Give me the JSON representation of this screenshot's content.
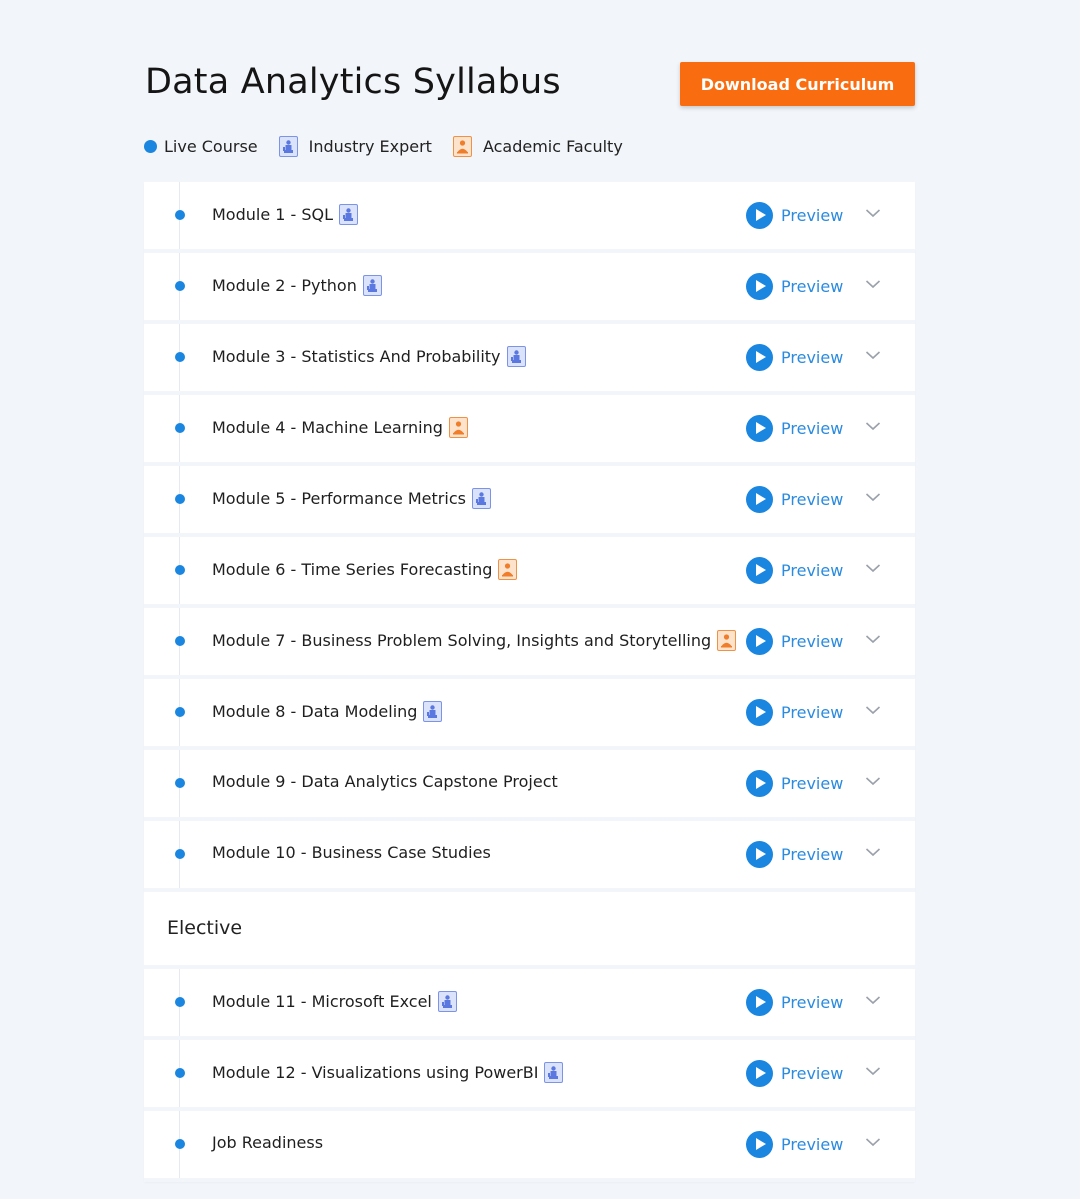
{
  "header": {
    "title": "Data Analytics Syllabus",
    "download_label": "Download Curriculum"
  },
  "legend": {
    "live": "Live Course",
    "expert": "Industry Expert",
    "faculty": "Academic Faculty"
  },
  "colors": {
    "accent_blue": "#1a86e0",
    "download_orange": "#f96d10",
    "background": "#f2f5f9"
  },
  "icons": {
    "expert": "industry-expert-icon",
    "faculty": "academic-faculty-icon",
    "preview": "play-icon",
    "expand": "chevron-down-icon"
  },
  "modules": [
    {
      "title": "Module 1 - SQL",
      "badge": "expert",
      "preview": "Preview"
    },
    {
      "title": "Module 2 - Python",
      "badge": "expert",
      "preview": "Preview"
    },
    {
      "title": "Module 3 - Statistics And Probability",
      "badge": "expert",
      "preview": "Preview"
    },
    {
      "title": "Module 4 - Machine Learning",
      "badge": "faculty",
      "preview": "Preview"
    },
    {
      "title": "Module 5 - Performance Metrics",
      "badge": "expert",
      "preview": "Preview"
    },
    {
      "title": "Module 6 - Time Series Forecasting",
      "badge": "faculty",
      "preview": "Preview"
    },
    {
      "title": "Module 7 - Business Problem Solving, Insights and Storytelling",
      "badge": "faculty",
      "preview": "Preview"
    },
    {
      "title": "Module 8 - Data Modeling",
      "badge": "expert",
      "preview": "Preview"
    },
    {
      "title": "Module 9 - Data Analytics Capstone Project",
      "badge": "",
      "preview": "Preview"
    },
    {
      "title": "Module 10 - Business Case Studies",
      "badge": "",
      "preview": "Preview"
    }
  ],
  "elective": {
    "title": "Elective",
    "modules": [
      {
        "title": "Module 11 - Microsoft Excel",
        "badge": "expert",
        "preview": "Preview"
      },
      {
        "title": "Module 12 - Visualizations using PowerBI",
        "badge": "expert",
        "preview": "Preview"
      },
      {
        "title": "Job Readiness",
        "badge": "",
        "preview": "Preview"
      }
    ]
  }
}
